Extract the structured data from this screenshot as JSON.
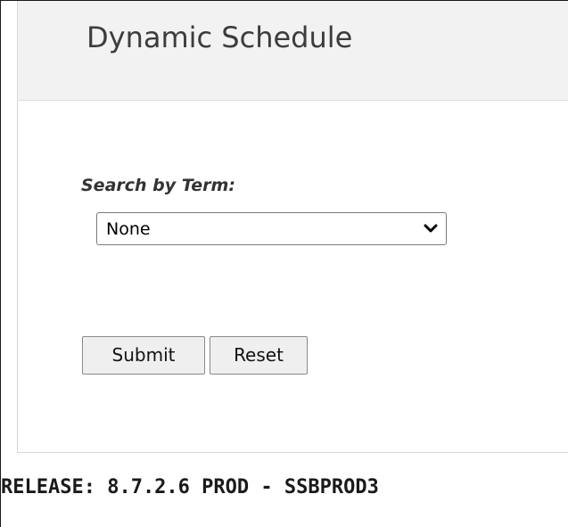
{
  "header": {
    "title": "Dynamic Schedule"
  },
  "search": {
    "label": "Search by Term:",
    "selected": "None",
    "options": [
      "None"
    ]
  },
  "actions": {
    "submit_label": "Submit",
    "reset_label": "Reset"
  },
  "footer": {
    "release": "RELEASE: 8.7.2.6 PROD - SSBPROD3"
  },
  "icons": {
    "select_chevron": "chevron-down-icon"
  }
}
